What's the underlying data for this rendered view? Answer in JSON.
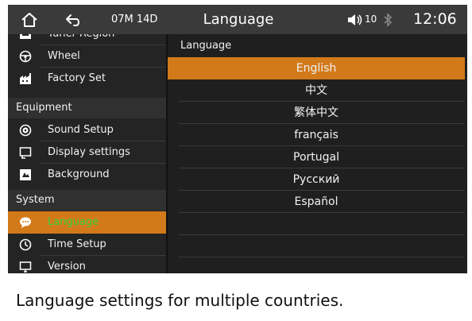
{
  "topbar": {
    "date": "07M 14D",
    "title": "Language",
    "volume_level": "10",
    "time": "12:06",
    "icons": [
      "home-icon",
      "back-icon",
      "volume-icon",
      "bluetooth-icon"
    ]
  },
  "sidebar": {
    "partial_item": {
      "label": "Tuner Region",
      "icon": "radio-icon"
    },
    "group1": [
      {
        "label": "Wheel",
        "icon": "steering-wheel-icon"
      },
      {
        "label": "Factory Set",
        "icon": "factory-icon"
      }
    ],
    "equipment_header": "Equipment",
    "equipment": [
      {
        "label": "Sound Setup",
        "icon": "sound-icon"
      },
      {
        "label": "Display settings",
        "icon": "display-icon"
      },
      {
        "label": "Background",
        "icon": "background-icon"
      }
    ],
    "system_header": "System",
    "system": [
      {
        "label": "Language",
        "icon": "language-icon",
        "active": true
      },
      {
        "label": "Time Setup",
        "icon": "clock-icon"
      },
      {
        "label": "Version",
        "icon": "monitor-icon"
      }
    ]
  },
  "main": {
    "section_label": "Language",
    "languages": [
      "English",
      "中文",
      "繁体中文",
      "français",
      "Portugal",
      "Русский",
      "Español"
    ],
    "selected": "English"
  },
  "caption": "Language settings for multiple countries.",
  "colors": {
    "accent": "#d27a1a",
    "active_text": "#38d23c",
    "topbar": "#3a3a3a"
  }
}
